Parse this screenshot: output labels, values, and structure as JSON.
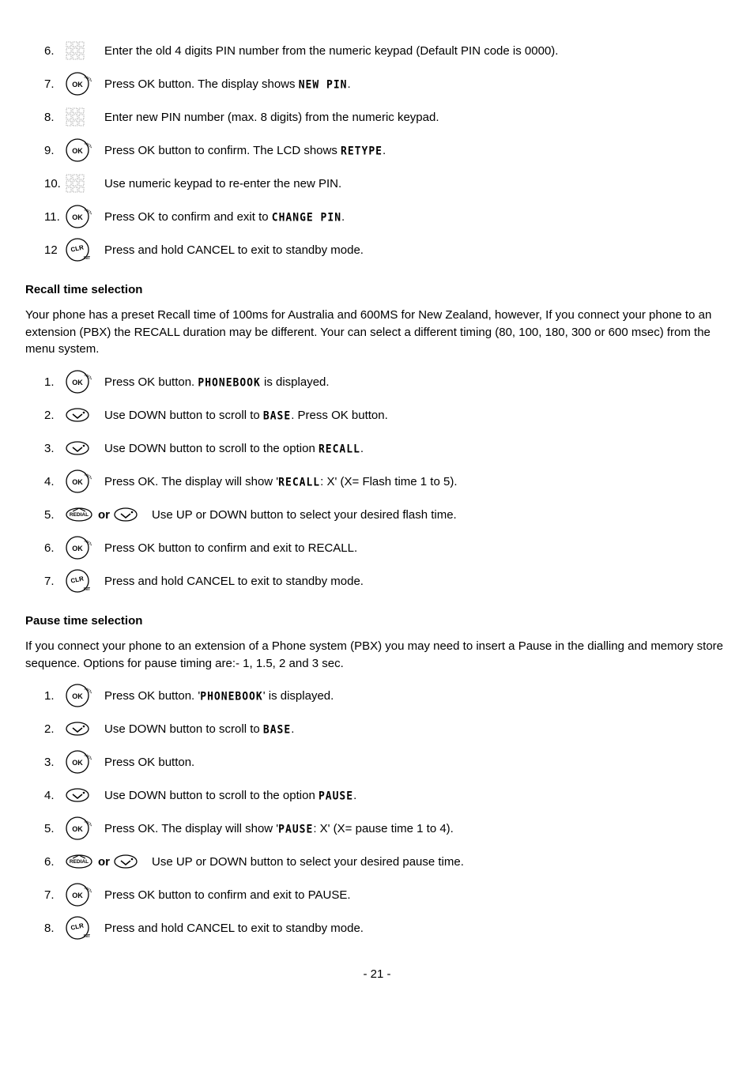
{
  "section1": {
    "steps": [
      {
        "n": "6.",
        "icon": "keypad",
        "txt1": "Enter the old 4 digits PIN number from the numeric keypad (Default PIN code is 0000)."
      },
      {
        "n": "7.",
        "icon": "ok",
        "txt1": "Press OK button.  The display shows ",
        "seg": "NEW PIN",
        "txt2": "."
      },
      {
        "n": "8.",
        "icon": "keypad",
        "txt1": "Enter new PIN number (max. 8 digits) from the numeric keypad."
      },
      {
        "n": "9.",
        "icon": "ok",
        "txt1": "Press OK button to confirm.  The LCD shows ",
        "seg": "RETYPE",
        "txt2": "."
      },
      {
        "n": "10.",
        "icon": "keypad",
        "txt1": "Use numeric keypad to re-enter the new PIN."
      },
      {
        "n": "11.",
        "icon": "ok",
        "txt1": "Press OK to confirm and exit to ",
        "seg": "CHANGE PIN",
        "txt2": "."
      },
      {
        "n": "12",
        "icon": "clr",
        "txt1": "Press and hold CANCEL to exit to standby mode."
      }
    ]
  },
  "section2": {
    "title": "Recall time selection",
    "intro": "Your phone has a preset Recall time of 100ms for Australia and 600MS for New Zealand, however, If you connect your phone to an extension (PBX) the RECALL duration may be different. Your can select a different timing (80, 100, 180, 300 or 600 msec) from the menu system.",
    "steps": [
      {
        "n": "1.",
        "icon": "ok",
        "txt1": "Press OK button.   ",
        "seg": "PHONEBOOK",
        "txt2": " is displayed."
      },
      {
        "n": "2.",
        "icon": "down",
        "txt1": "Use DOWN button to scroll to ",
        "seg": "BASE",
        "txt2": ". Press OK button."
      },
      {
        "n": "3.",
        "icon": "down",
        "txt1": "Use DOWN button to scroll to the option ",
        "seg": "RECALL",
        "txt2": "."
      },
      {
        "n": "4.",
        "icon": "ok",
        "txt1": "Press OK.  The display will show '",
        "seg": "RECALL",
        "txt2": ": X' (X= Flash time 1 to 5)."
      },
      {
        "n": "5.",
        "icon": "redial-or-down",
        "txt1": "Use UP or DOWN button to select your desired flash time."
      },
      {
        "n": "6.",
        "icon": "ok",
        "txt1": "Press OK button to confirm and exit to RECALL."
      },
      {
        "n": "7.",
        "icon": "clr",
        "txt1": "Press and hold CANCEL to exit to standby mode."
      }
    ]
  },
  "section3": {
    "title": "Pause time selection",
    "intro": "If you connect your phone to an extension of a Phone system (PBX) you may need to insert a Pause in the dialling and memory store sequence. Options for pause timing are:-  1, 1.5, 2 and 3 sec.",
    "steps": [
      {
        "n": "1.",
        "icon": "ok",
        "txt1": "Press OK button.   '",
        "seg": "PHONEBOOK",
        "txt2": "' is displayed."
      },
      {
        "n": "2.",
        "icon": "down",
        "txt1": "Use DOWN button to scroll to  ",
        "seg": "BASE",
        "txt2": "."
      },
      {
        "n": "3.",
        "icon": "ok",
        "txt1": " Press OK button."
      },
      {
        "n": "4.",
        "icon": "down",
        "txt1": "Use DOWN button to scroll to the option  ",
        "seg": "PAUSE",
        "txt2": "."
      },
      {
        "n": "5.",
        "icon": "ok",
        "txt1": " Press OK.  The display will show '",
        "seg": "PAUSE",
        "txt2": ": X' (X= pause time 1 to 4)."
      },
      {
        "n": "6.",
        "icon": "redial-or-down",
        "txt1": "Use UP or DOWN button to select your desired pause time."
      },
      {
        "n": "7.",
        "icon": "ok",
        "txt1": "Press OK button to confirm and exit to PAUSE."
      },
      {
        "n": "8.",
        "icon": "clr",
        "txt1": "Press and hold CANCEL to exit to standby mode."
      }
    ]
  },
  "or_label": "or",
  "page": "- 21 -"
}
